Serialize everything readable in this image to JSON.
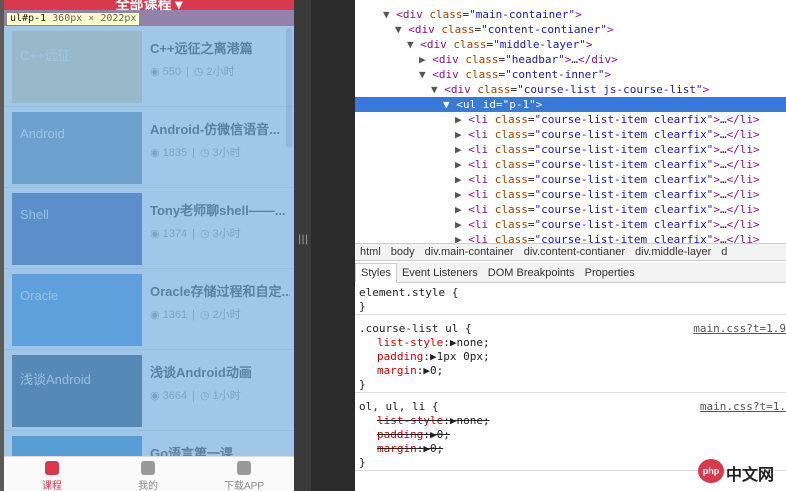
{
  "phone": {
    "header_title": "全部课程 ▾",
    "element_label": "ul#p-1",
    "element_size": "360px × 2022px",
    "courses": [
      {
        "title": "C++远征之离港篇",
        "views": "550",
        "duration": "2小时",
        "thumb_text": "C++远征",
        "thumb_color": "#e9d9a8"
      },
      {
        "title": "Android-仿微信语音...",
        "views": "1835",
        "duration": "3小时",
        "thumb_text": "Android",
        "thumb_color": "#6a8fb0"
      },
      {
        "title": "Tony老师聊shell——...",
        "views": "1374",
        "duration": "3小时",
        "thumb_text": "Shell",
        "thumb_color": "#3a5fa8"
      },
      {
        "title": "Oracle存储过程和自定...",
        "views": "1361",
        "duration": "2小时",
        "thumb_text": "Oracle",
        "thumb_color": "#3f8fd8"
      },
      {
        "title": "浅谈Android动画",
        "views": "3664",
        "duration": "1小时",
        "thumb_text": "浅谈Android",
        "thumb_color": "#2a4d6e"
      },
      {
        "title": "Go语言第一课",
        "views": "",
        "duration": "",
        "thumb_text": "",
        "thumb_color": "#2f86c8"
      }
    ],
    "tabs": [
      {
        "label": "课程",
        "active": true
      },
      {
        "label": "我的",
        "active": false
      },
      {
        "label": "下载APP",
        "active": false
      }
    ]
  },
  "devtools": {
    "dom_lines": [
      {
        "indent": 2,
        "tri": "▼",
        "html": "<div class=\"main-container\">"
      },
      {
        "indent": 3,
        "tri": "▼",
        "html": "<div class=\"content-contianer\">"
      },
      {
        "indent": 4,
        "tri": "▼",
        "html": "<div class=\"middle-layer\">"
      },
      {
        "indent": 5,
        "tri": "▶",
        "html": "<div class=\"headbar\">…</div>"
      },
      {
        "indent": 5,
        "tri": "▼",
        "html": "<div class=\"content-inner\">"
      },
      {
        "indent": 6,
        "tri": "▼",
        "html": "<div class=\"course-list js-course-list\">"
      },
      {
        "indent": 7,
        "tri": "▼",
        "html": "<ul id=\"p-1\">",
        "selected": true
      },
      {
        "indent": 8,
        "tri": "▶",
        "html": "<li class=\"course-list-item clearfix\">…</li>"
      },
      {
        "indent": 8,
        "tri": "▶",
        "html": "<li class=\"course-list-item clearfix\">…</li>"
      },
      {
        "indent": 8,
        "tri": "▶",
        "html": "<li class=\"course-list-item clearfix\">…</li>"
      },
      {
        "indent": 8,
        "tri": "▶",
        "html": "<li class=\"course-list-item clearfix\">…</li>"
      },
      {
        "indent": 8,
        "tri": "▶",
        "html": "<li class=\"course-list-item clearfix\">…</li>"
      },
      {
        "indent": 8,
        "tri": "▶",
        "html": "<li class=\"course-list-item clearfix\">…</li>"
      },
      {
        "indent": 8,
        "tri": "▶",
        "html": "<li class=\"course-list-item clearfix\">…</li>"
      },
      {
        "indent": 8,
        "tri": "▶",
        "html": "<li class=\"course-list-item clearfix\">…</li>"
      },
      {
        "indent": 8,
        "tri": "▶",
        "html": "<li class=\"course-list-item clearfix\">…</li>"
      },
      {
        "indent": 8,
        "tri": "▶",
        "html": "<li class=\"course-list-item clearfix\">…</li>"
      }
    ],
    "breadcrumbs": [
      "html",
      "body",
      "div.main-container",
      "div.content-contianer",
      "div.middle-layer",
      "d"
    ],
    "panel_tabs": [
      "Styles",
      "Event Listeners",
      "DOM Breakpoints",
      "Properties"
    ],
    "rules": [
      {
        "selector": "element.style {",
        "source": "",
        "props": [],
        "close": "}"
      },
      {
        "selector": ".course-list ul {",
        "source": "main.css?t=1.9",
        "props": [
          {
            "name": "list-style",
            "value": "none;",
            "struck": false
          },
          {
            "name": "padding",
            "value": "1px 0px;",
            "struck": false
          },
          {
            "name": "margin",
            "value": "0;",
            "struck": false
          }
        ],
        "close": "}"
      },
      {
        "selector": "ol, ul, li {",
        "source": "main.css?t=1.",
        "props": [
          {
            "name": "list-style",
            "value": "none;",
            "struck": true
          },
          {
            "name": "padding",
            "value": "0;",
            "struck": true
          },
          {
            "name": "margin",
            "value": "0;",
            "struck": true
          }
        ],
        "close": "}"
      }
    ],
    "logo_circle": "php",
    "logo_text": "中文网",
    "splitter_grip": "|||"
  }
}
